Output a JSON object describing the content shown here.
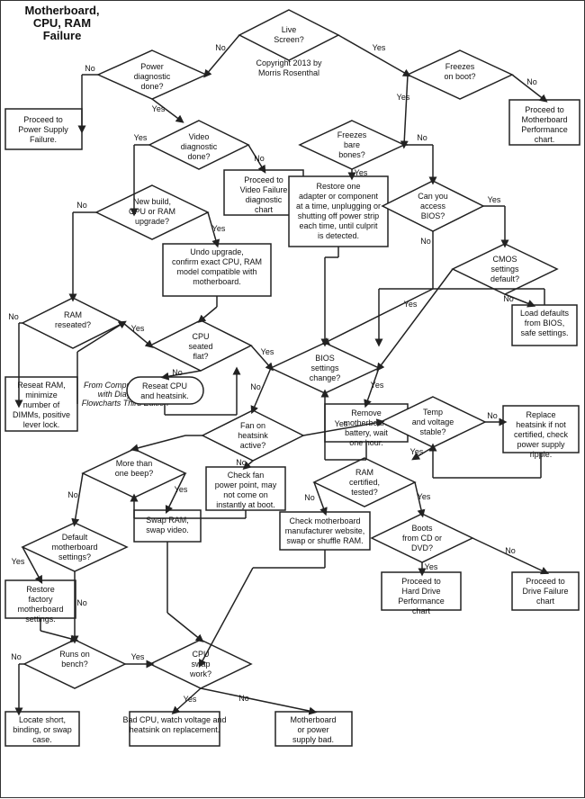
{
  "chart": {
    "title": "Motherboard, CPU, RAM Failure",
    "copyright": "Copyright 2013 by Morris Rosenthal",
    "edition_note": "From Computer Repair with Diagnostic Flowcharts Third Edition"
  },
  "nodes": {
    "live_screen": "Live Screen?",
    "power_diag": "Power diagnostic done?",
    "video_diag": "Video diagnostic done?",
    "freezes_boot": "Freezes on boot?",
    "freezes_bare": "Freezes bare bones?",
    "access_bios": "Can you access BIOS?",
    "cmos_default": "CMOS settings default?",
    "new_build": "New build, CPU or RAM upgrade?",
    "ram_reseated": "RAM reseated?",
    "cpu_seated": "CPU seated flat?",
    "bios_change": "BIOS settings change?",
    "fan_heatsink": "Fan on heatsink active?",
    "temp_voltage": "Temp and voltage stable?",
    "more_beep": "More than one beep?",
    "ram_certified": "RAM certified, tested?",
    "default_mb": "Default motherboard settings?",
    "boots_cd": "Boots from CD or DVD?",
    "runs_bench": "Runs on bench?",
    "cpu_swap": "CPU swap work?",
    "proceed_power": "Proceed to Power Supply Failure.",
    "proceed_video": "Proceed to Video Failure diagnostic chart",
    "proceed_mb_perf": "Proceed to Motherboard Performance chart.",
    "undo_upgrade": "Undo upgrade, confirm exact CPU, RAM model compatible with motherboard.",
    "restore_adapter": "Restore one adapter or component at a time, unplugging or shutting off power strip each time, until culprit is detected.",
    "load_defaults": "Load defaults from BIOS, safe settings.",
    "reseat_cpu": "Reseat CPU and heatsink.",
    "reseat_ram": "Reseat RAM, minimize number of DIMMs, positive lever lock.",
    "remove_battery": "Remove motherboard battery, wait one hour.",
    "replace_heatsink": "Replace heatsink if not certified, check power supply ripple.",
    "check_fan": "Check fan power point, may not come on instantly at boot.",
    "check_mb_website": "Check motherboard manufacturer website, swap or shuffle RAM.",
    "swap_ram_video": "Swap RAM, swap video.",
    "restore_factory": "Restore factory motherboard settings.",
    "proceed_hard_drive": "Proceed to Hard Drive Performance chart",
    "proceed_drive_failure": "Proceed to Drive Failure chart",
    "locate_short": "Locate short, binding, or swap case.",
    "bad_cpu": "Bad CPU, watch voltage and heatsink on replacement.",
    "mb_bad": "Motherboard or power supply bad."
  }
}
